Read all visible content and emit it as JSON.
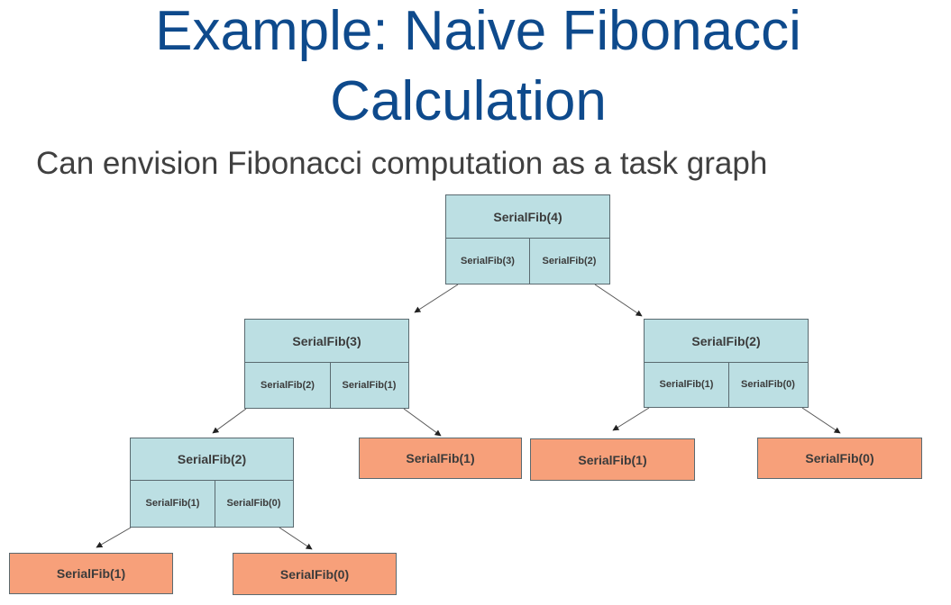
{
  "slide": {
    "title_line1": "Example: Naive Fibonacci",
    "title_line2": "Calculation",
    "subtitle": "Can envision Fibonacci computation as a task graph"
  },
  "graph": {
    "nodes": {
      "fib4": {
        "label": "SerialFib(4)",
        "left": "SerialFib(3)",
        "right": "SerialFib(2)"
      },
      "fib3": {
        "label": "SerialFib(3)",
        "left": "SerialFib(2)",
        "right": "SerialFib(1)"
      },
      "fib2_right": {
        "label": "SerialFib(2)",
        "left": "SerialFib(1)",
        "right": "SerialFib(0)"
      },
      "fib2_left": {
        "label": "SerialFib(2)",
        "left": "SerialFib(1)",
        "right": "SerialFib(0)"
      },
      "leaf_fib1_a": {
        "label": "SerialFib(1)"
      },
      "leaf_fib1_b": {
        "label": "SerialFib(1)"
      },
      "leaf_fib0_a": {
        "label": "SerialFib(0)"
      },
      "leaf_fib1_c": {
        "label": "SerialFib(1)"
      },
      "leaf_fib0_b": {
        "label": "SerialFib(0)"
      }
    },
    "edges": [
      {
        "from": "fib4",
        "to": "fib3"
      },
      {
        "from": "fib4",
        "to": "fib2_right"
      },
      {
        "from": "fib3",
        "to": "fib2_left"
      },
      {
        "from": "fib3",
        "to": "leaf_fib1_a"
      },
      {
        "from": "fib2_right",
        "to": "leaf_fib1_b"
      },
      {
        "from": "fib2_right",
        "to": "leaf_fib0_a"
      },
      {
        "from": "fib2_left",
        "to": "leaf_fib1_c"
      },
      {
        "from": "fib2_left",
        "to": "leaf_fib0_b"
      }
    ]
  }
}
